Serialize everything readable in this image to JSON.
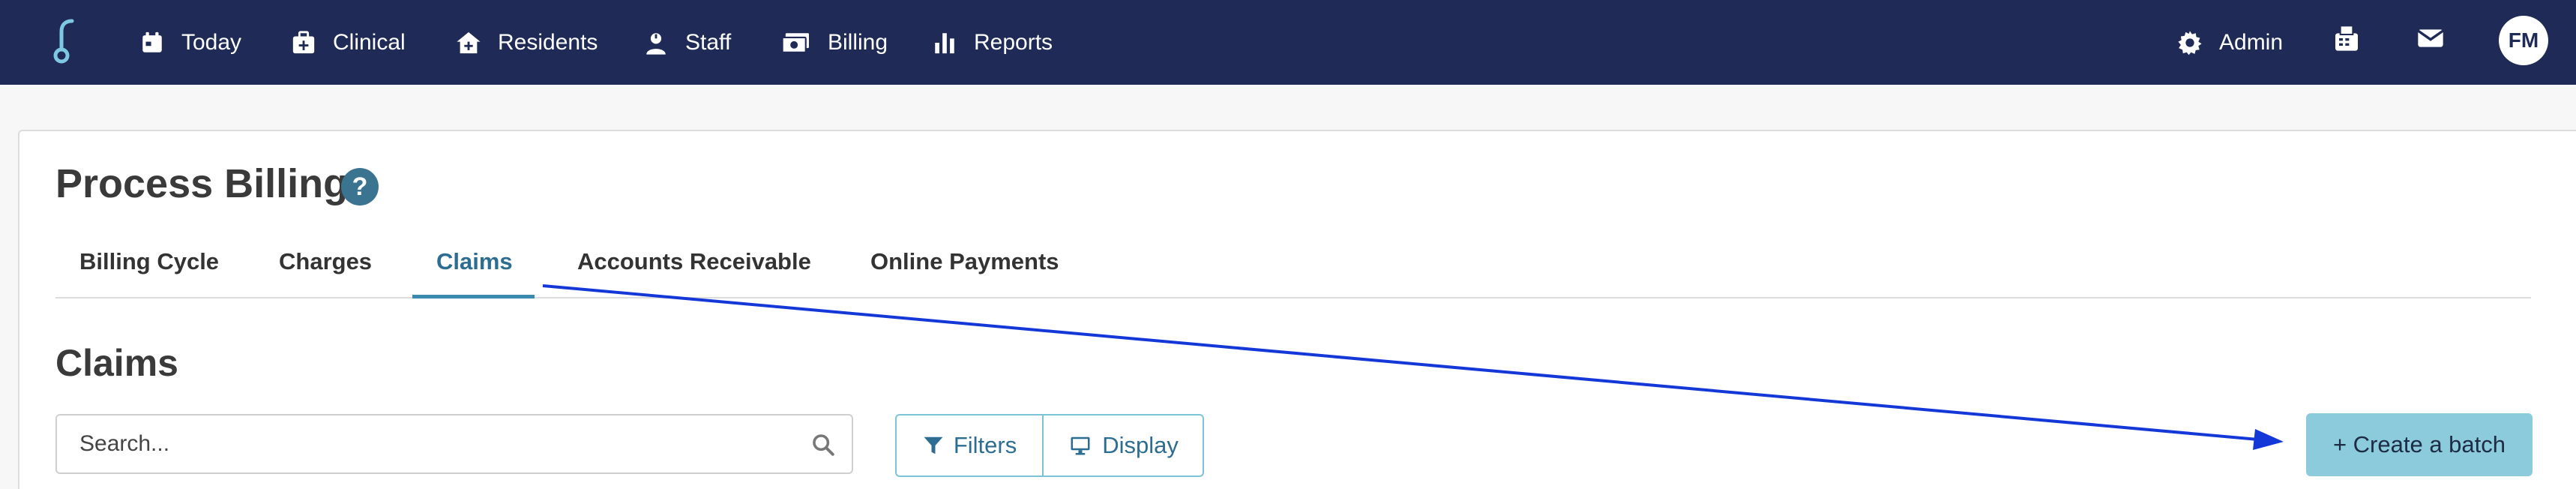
{
  "nav": {
    "items": [
      {
        "label": "Today",
        "icon": "calendar-icon"
      },
      {
        "label": "Clinical",
        "icon": "medical-bag-icon"
      },
      {
        "label": "Residents",
        "icon": "house-medical-icon"
      },
      {
        "label": "Staff",
        "icon": "user-nurse-icon"
      },
      {
        "label": "Billing",
        "icon": "money-bill-icon"
      },
      {
        "label": "Reports",
        "icon": "bar-chart-icon"
      }
    ],
    "admin_label": "Admin",
    "admin_icon": "gear-icon",
    "fax_icon": "fax-icon",
    "mail_icon": "envelope-icon",
    "avatar_initials": "FM",
    "bar_color": "#1f2b56"
  },
  "page": {
    "title": "Process Billing",
    "help_symbol": "?"
  },
  "tabs": [
    {
      "label": "Billing Cycle",
      "active": false
    },
    {
      "label": "Charges",
      "active": false
    },
    {
      "label": "Claims",
      "active": true
    },
    {
      "label": "Accounts Receivable",
      "active": false
    },
    {
      "label": "Online Payments",
      "active": false
    }
  ],
  "section": {
    "title": "Claims"
  },
  "search": {
    "placeholder": "Search...",
    "value": ""
  },
  "toolbar": {
    "filters_label": "Filters",
    "display_label": "Display",
    "create_label": "+ Create a batch"
  },
  "colors": {
    "accent": "#2d6d92",
    "create_button": "#8ccbdc",
    "annotation_arrow": "#1438d8"
  }
}
